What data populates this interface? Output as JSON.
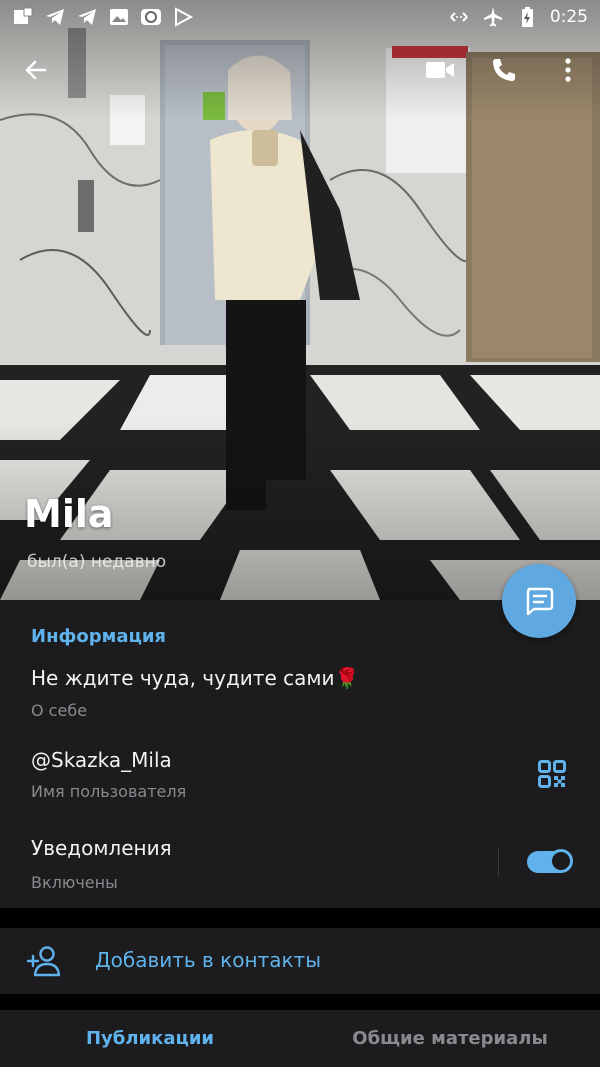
{
  "status_bar": {
    "time": "0:25",
    "left_icons": [
      "notification-square-icon",
      "telegram-icon",
      "telegram-icon",
      "image-icon",
      "app-icon",
      "play-icon"
    ],
    "right_icons": [
      "data-saver-icon",
      "airplane-mode-icon",
      "battery-charging-icon"
    ]
  },
  "toolbar": {
    "back_icon": "arrow-left-icon",
    "video_icon": "video-camera-icon",
    "call_icon": "phone-icon",
    "menu_icon": "more-vert-icon"
  },
  "profile": {
    "name": "Mila",
    "status": "был(а) недавно"
  },
  "info": {
    "section_title": "Информация",
    "bio": "Не ждите чуда, чудите сами",
    "bio_emoji": "🌹",
    "bio_label": "О себе",
    "username": "@Skazka_Mila",
    "username_label": "Имя пользователя",
    "notifications": "Уведомления",
    "notifications_status": "Включены",
    "notifications_enabled": true
  },
  "actions": {
    "add_contact": "Добавить в контакты"
  },
  "tabs": [
    {
      "label": "Публикации",
      "active": true
    },
    {
      "label": "Общие материалы",
      "active": false
    }
  ],
  "colors": {
    "accent": "#5fb2ec",
    "fab": "#5fa8e0",
    "card_bg": "#1c1c1e",
    "secondary_text": "#8a8a8e"
  }
}
